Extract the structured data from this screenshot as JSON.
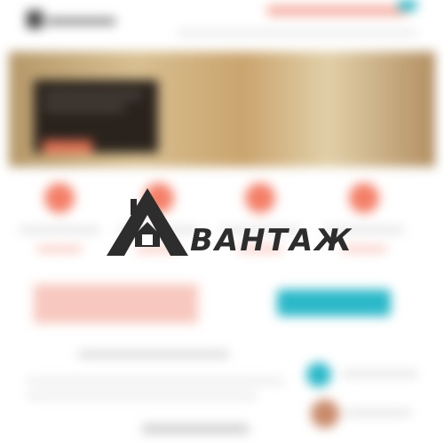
{
  "brand": {
    "name": "АВАНТАЖ",
    "logo_letter": "А",
    "text_suffix": "ВАНТАЖ",
    "colors": {
      "logo": "#2d2d2d"
    }
  },
  "background_site": {
    "state": "blurred",
    "colors": {
      "accent": "#f47f68",
      "teal": "#2ab8c8",
      "hero": "#c9a97a",
      "dark_panel": "#2a231d"
    },
    "feature_count": 4
  }
}
